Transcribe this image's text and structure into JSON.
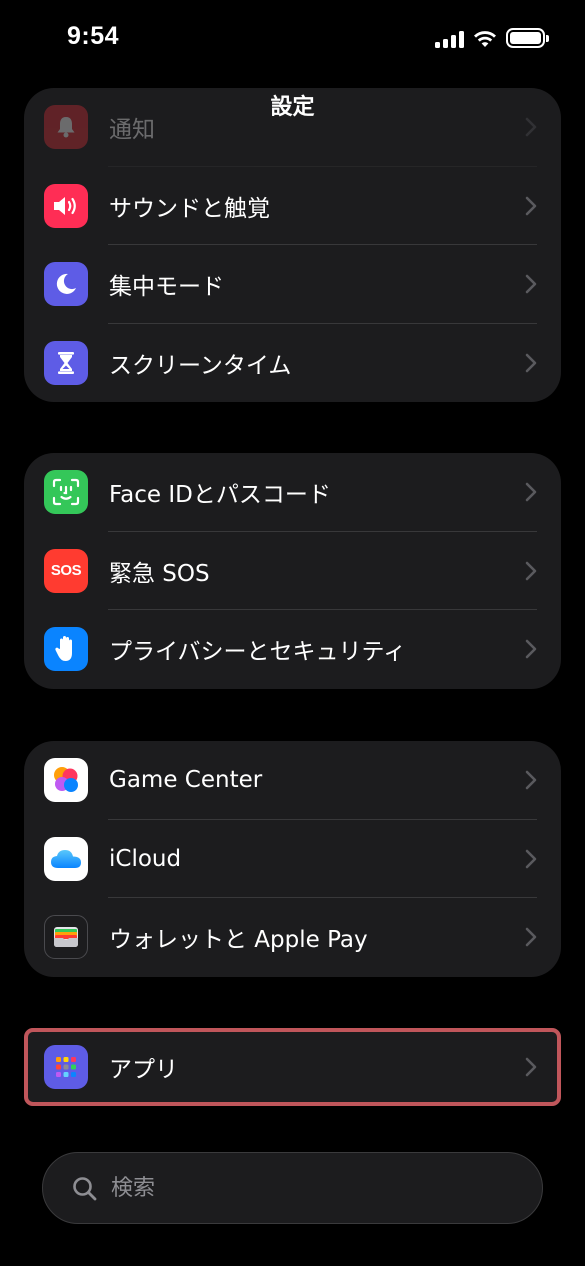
{
  "status_bar": {
    "time": "9:54"
  },
  "nav": {
    "title": "設定"
  },
  "groups": [
    {
      "rows": [
        {
          "label": "通知",
          "icon": "bell-icon",
          "color": "#ff3b30"
        },
        {
          "label": "サウンドと触覚",
          "icon": "speaker-icon",
          "color": "#ff2d55"
        },
        {
          "label": "集中モード",
          "icon": "moon-icon",
          "color": "#5e5ce6"
        },
        {
          "label": "スクリーンタイム",
          "icon": "hourglass-icon",
          "color": "#5e5ce6"
        }
      ]
    },
    {
      "rows": [
        {
          "label": "Face IDとパスコード",
          "icon": "face-id-icon",
          "color": "#34c759"
        },
        {
          "label": "緊急 SOS",
          "icon": "sos-icon",
          "color": "#ff3b30",
          "icon_text": "SOS"
        },
        {
          "label": "プライバシーとセキュリティ",
          "icon": "hand-icon",
          "color": "#0a84ff"
        }
      ]
    },
    {
      "rows": [
        {
          "label": "Game Center",
          "icon": "game-center-icon",
          "color": "#ffffff"
        },
        {
          "label": "iCloud",
          "icon": "cloud-icon",
          "color": "#ffffff"
        },
        {
          "label": "ウォレットと Apple Pay",
          "icon": "wallet-icon",
          "color": "#1c1c1e"
        }
      ]
    },
    {
      "rows": [
        {
          "label": "アプリ",
          "icon": "apps-grid-icon",
          "color": "#5e5ce6"
        }
      ]
    }
  ],
  "search": {
    "placeholder": "検索"
  }
}
